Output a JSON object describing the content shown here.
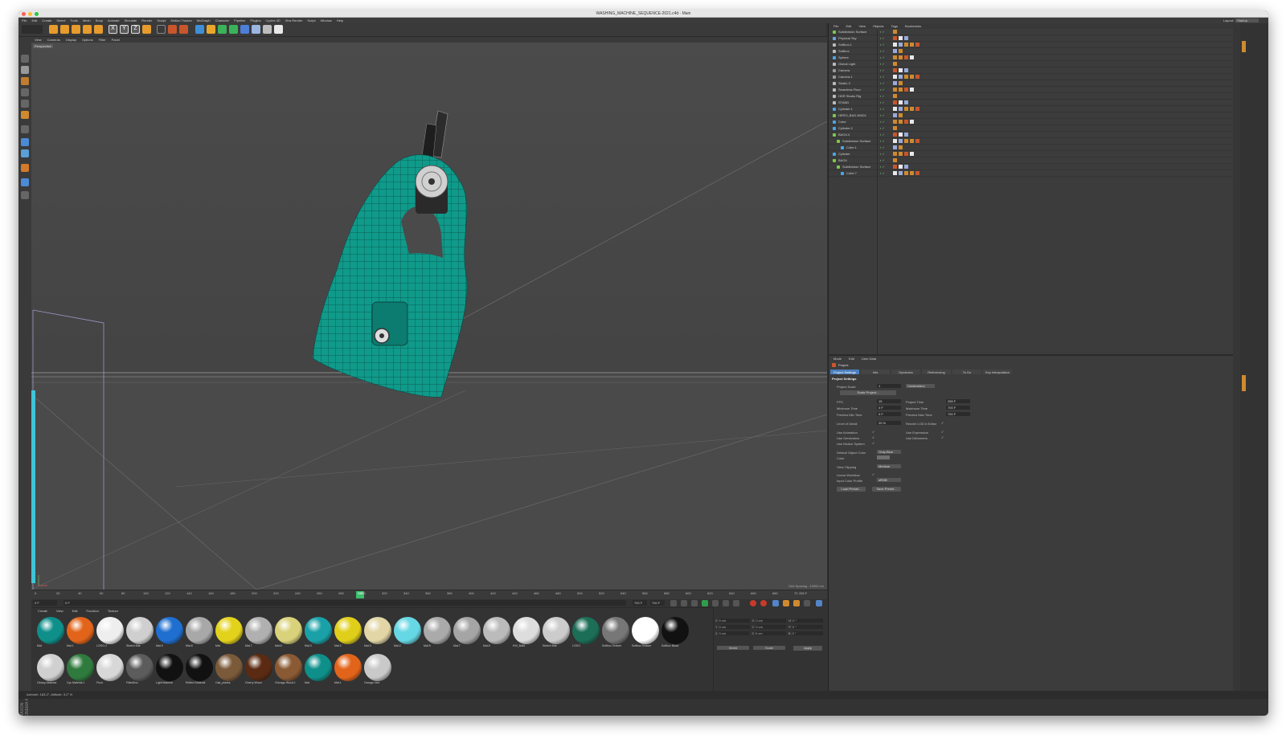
{
  "window": {
    "title": "WASHING_MACHINE_SEQUENCE-2021.c4d - Main"
  },
  "menubar": {
    "items": [
      "File",
      "Edit",
      "Create",
      "Select",
      "Tools",
      "Mesh",
      "Snap",
      "Animate",
      "Simulate",
      "Render",
      "Sculpt",
      "Motion Tracker",
      "MoGraph",
      "Character",
      "Pipeline",
      "Plugins",
      "Cycles 4D",
      "Xtra Render",
      "Script",
      "Window",
      "Help"
    ],
    "layout_label": "Layout:",
    "layout_value": "Startup"
  },
  "toolbar": {
    "axis": [
      "X",
      "Y",
      "Z"
    ]
  },
  "viewport": {
    "menu": [
      "View",
      "Cameras",
      "Display",
      "Options",
      "Filter",
      "Panel"
    ],
    "camera_label": "Perspective",
    "grid_spacing": "Grid Spacing : 10000 cm"
  },
  "timeline": {
    "ticks": [
      "0",
      "20",
      "40",
      "60",
      "80",
      "100",
      "120",
      "140",
      "160",
      "180",
      "200",
      "220",
      "240",
      "260",
      "280",
      "300",
      "320",
      "340",
      "360",
      "380",
      "400",
      "420",
      "440",
      "460",
      "480",
      "500",
      "520",
      "540",
      "560",
      "580",
      "600",
      "620",
      "640",
      "660",
      "680",
      "70"
    ],
    "current_frame": "285",
    "end_label": "285 F"
  },
  "transport": {
    "start": "0 F",
    "field2": "0 F",
    "end1": "700 F",
    "end2": "700 F"
  },
  "materials": {
    "menu": [
      "Create",
      "View",
      "Edit",
      "Function",
      "Texture"
    ],
    "row1": [
      {
        "name": "Mat",
        "color": "#0e8f8a"
      },
      {
        "name": "Mat.1",
        "color": "#e2641a"
      },
      {
        "name": "LOGO.2",
        "color": "#eeeeee"
      },
      {
        "name": "Sketch Mat",
        "color": "#cfcfcf"
      },
      {
        "name": "Mat.9",
        "color": "#1f6fd0"
      },
      {
        "name": "Mat.8",
        "color": "#a8a8a8"
      },
      {
        "name": "Mat",
        "color": "#e3d21c"
      },
      {
        "name": "Mat.7",
        "color": "#b0b0b0"
      },
      {
        "name": "Mat.6",
        "color": "#d9d27a"
      },
      {
        "name": "Mat.3",
        "color": "#1aa1a8"
      },
      {
        "name": "Mat.2",
        "color": "#e0cf1a"
      },
      {
        "name": "Mat.3",
        "color": "#e2d6a6"
      },
      {
        "name": "Mat.2",
        "color": "#66d7e4"
      },
      {
        "name": "Mat.5",
        "color": "#aaaaaa"
      },
      {
        "name": "Mat.7",
        "color": "#a5a5a5"
      },
      {
        "name": "Mat.8",
        "color": "#bbbbbb"
      },
      {
        "name": "KW_Ball1",
        "color": "#dddddd"
      },
      {
        "name": "Sketch Mat",
        "color": "#cccccc"
      },
      {
        "name": "LOGO",
        "color": "#1d6e57"
      },
      {
        "name": "Softbox Texture",
        "color": "#777777"
      },
      {
        "name": "Softbox Texture",
        "color": "#ffffff"
      },
      {
        "name": "Softbox Black",
        "color": "#111111"
      }
    ],
    "row2": [
      {
        "name": "Glossy Abstract",
        "color": "#d0d0d0"
      },
      {
        "name": "Cyc Material.1",
        "color": "#2f7a3d"
      },
      {
        "name": "Floor",
        "color": "#d8d8d8"
      },
      {
        "name": "FiltedDoc",
        "color": "#5c5c5c"
      },
      {
        "name": "Light Material",
        "color": "#111111"
      },
      {
        "name": "Reflect Material",
        "color": "#111111"
      },
      {
        "name": "Oak_planks",
        "color": "#7b5a3a"
      },
      {
        "name": "Cherry Wood",
        "color": "#5a2b12"
      },
      {
        "name": "Chicago Wood.1",
        "color": "#8a5a34"
      },
      {
        "name": "Mat",
        "color": "#0e8f8a"
      },
      {
        "name": "Mat.1",
        "color": "#e2641a"
      },
      {
        "name": "Orange Line",
        "color": "#c9c9c9"
      }
    ]
  },
  "coords": {
    "rows": [
      [
        "X",
        "0 cm",
        "X",
        "0 cm",
        "H",
        "0 °"
      ],
      [
        "Y",
        "0 cm",
        "Y",
        "0 cm",
        "P",
        "0 °"
      ],
      [
        "Z",
        "0 cm",
        "Z",
        "0 cm",
        "B",
        "0 °"
      ]
    ],
    "mode1": "World",
    "mode2": "Scale",
    "apply": "Apply"
  },
  "status": {
    "text": "Azimuth: 183.2°, Altitude: 3.2°  N"
  },
  "brand": "MAXON CINEMA 4D",
  "objects": {
    "menu": [
      "File",
      "Edit",
      "View",
      "Objects",
      "Tags",
      "Bookmarks"
    ],
    "items": [
      {
        "name": "Subdivision Surface",
        "indent": 0,
        "icon": "#7cc94b"
      },
      {
        "name": "Physical Sky",
        "indent": 0,
        "icon": "#6fa7e0"
      },
      {
        "name": "Softbox.1",
        "indent": 0,
        "icon": "#bbbbbb"
      },
      {
        "name": "Softbox",
        "indent": 0,
        "icon": "#bbbbbb"
      },
      {
        "name": "Sphere",
        "indent": 0,
        "icon": "#4aa6e8"
      },
      {
        "name": "Global Light",
        "indent": 0,
        "icon": "#bbbbbb"
      },
      {
        "name": "Camera",
        "indent": 0,
        "icon": "#9a9a9a"
      },
      {
        "name": "Camera.1",
        "indent": 0,
        "icon": "#9a9a9a"
      },
      {
        "name": "Studio 3",
        "indent": 0,
        "icon": "#bbbbbb"
      },
      {
        "name": "Seamless Floor",
        "indent": 0,
        "icon": "#bbbbbb"
      },
      {
        "name": "HDR Studio Rig",
        "indent": 0,
        "icon": "#bbbbbb"
      },
      {
        "name": "STAND",
        "indent": 0,
        "icon": "#bbbbbb"
      },
      {
        "name": "Cylinder.1",
        "indent": 0,
        "icon": "#4aa6e8"
      },
      {
        "name": "HERO_BAG-WAD1",
        "indent": 0,
        "icon": "#7cc94b"
      },
      {
        "name": "Cube",
        "indent": 0,
        "icon": "#4aa6e8"
      },
      {
        "name": "Cylinder.2",
        "indent": 0,
        "icon": "#4aa6e8"
      },
      {
        "name": "BAG4.4",
        "indent": 0,
        "icon": "#7cc94b"
      },
      {
        "name": "Subdivision Surface",
        "indent": 1,
        "icon": "#7cc94b"
      },
      {
        "name": "Cube.1",
        "indent": 2,
        "icon": "#4aa6e8"
      },
      {
        "name": "Cylinder",
        "indent": 0,
        "icon": "#4aa6e8"
      },
      {
        "name": "BAG4",
        "indent": 0,
        "icon": "#7cc94b"
      },
      {
        "name": "Subdivision Surface",
        "indent": 1,
        "icon": "#7cc94b"
      },
      {
        "name": "Cube.7",
        "indent": 2,
        "icon": "#4aa6e8"
      }
    ]
  },
  "attributes": {
    "menu": [
      "Mode",
      "Edit",
      "User Data"
    ],
    "object": "Project",
    "tabs": [
      "Project Settings",
      "Info",
      "Dynamics",
      "Referencing",
      "To Do",
      "Key Interpolation"
    ],
    "section": "Project Settings",
    "project_scale_label": "Project Scale",
    "project_scale": "1",
    "units": "Centimeters",
    "scale_btn": "Scale Project...",
    "fps_label": "FPS",
    "fps": "15",
    "project_time_label": "Project Time",
    "project_time": "285 F",
    "min_time_label": "Minimum Time",
    "min_time": "0 F",
    "max_time_label": "Maximum Time",
    "max_time": "700 F",
    "prev_min_label": "Preview Min Time",
    "prev_min": "0 F",
    "prev_max_label": "Preview Max Time",
    "prev_max": "700 F",
    "lod_label": "Level of Detail",
    "lod": "25 %",
    "render_lod_label": "Render LOD in Editor",
    "use_anim": "Use Animation",
    "use_expr": "Use Expression",
    "use_gen": "Use Generators",
    "use_def": "Use Deformers",
    "use_motion": "Use Motion System",
    "def_color_label": "Default Object Color",
    "def_color": "Gray-Blue",
    "color_label": "Color",
    "view_clip_label": "View Clipping",
    "view_clip": "Medium",
    "linear_label": "Linear Workflow",
    "input_profile_label": "Input Color Profile",
    "input_profile": "sRGB",
    "load_btn": "Load Preset...",
    "save_btn": "Save Preset..."
  }
}
